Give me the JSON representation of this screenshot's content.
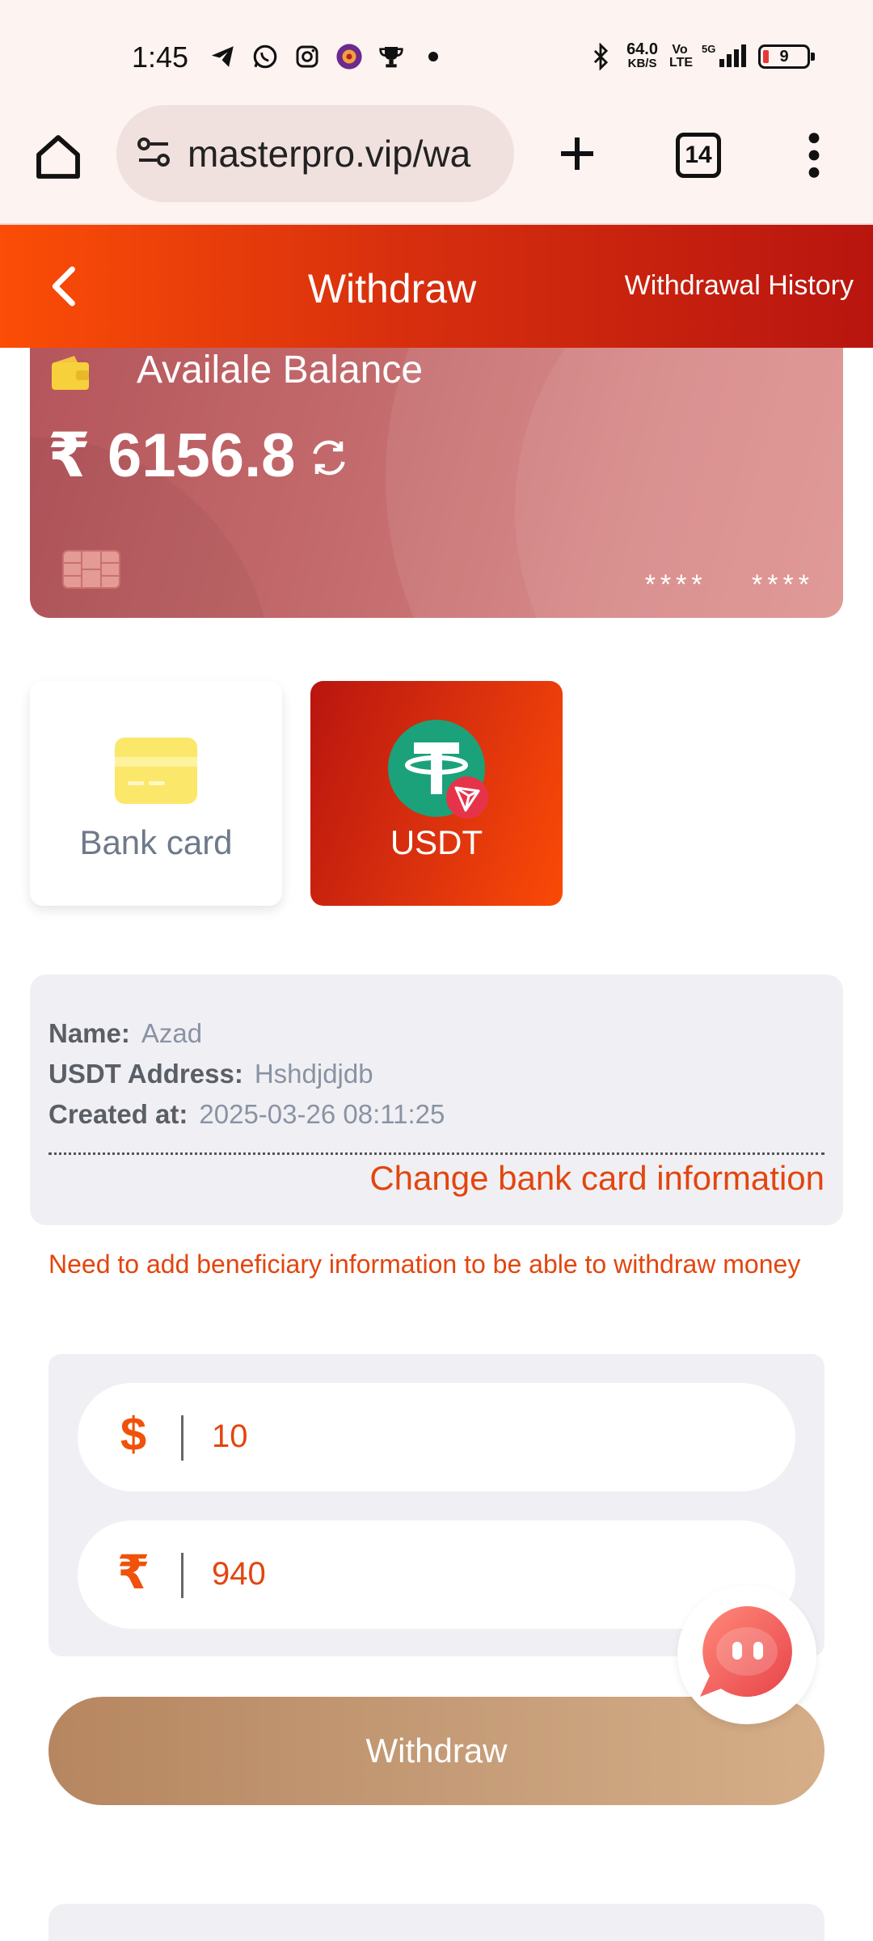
{
  "status_bar": {
    "time": "1:45",
    "net_speed_value": "64.0",
    "net_speed_unit": "KB/S",
    "volte": "Vo LTE",
    "network": "5G",
    "battery": "9"
  },
  "browser": {
    "url": "masterpro.vip/wa",
    "tab_count": "14"
  },
  "header": {
    "title": "Withdraw",
    "history_link": "Withdrawal History"
  },
  "balance": {
    "label": "Availale Balance",
    "value": "₹ 6156.8",
    "masked_card": "**** ****"
  },
  "methods": [
    {
      "label": "Bank card",
      "selected": false
    },
    {
      "label": "USDT",
      "selected": true
    }
  ],
  "account_info": {
    "name_label": "Name:",
    "name_value": "Azad",
    "address_label": "USDT Address:",
    "address_value": "Hshdjdjdb",
    "created_label": "Created at:",
    "created_value": "2025-03-26 08:11:25",
    "change_link": "Change bank card information"
  },
  "notice": "Need to add beneficiary information to be able to withdraw money",
  "amount": {
    "usd_symbol": "$",
    "usd_value": "10",
    "inr_symbol": "₹",
    "inr_value": "940"
  },
  "withdraw_button": "Withdraw",
  "colors": {
    "accent": "#e3450e",
    "header_start": "#fb4d06",
    "header_end": "#b8150f",
    "button_start": "#b68660",
    "button_end": "#d5ae88",
    "usdt_green": "#1ba27a"
  }
}
